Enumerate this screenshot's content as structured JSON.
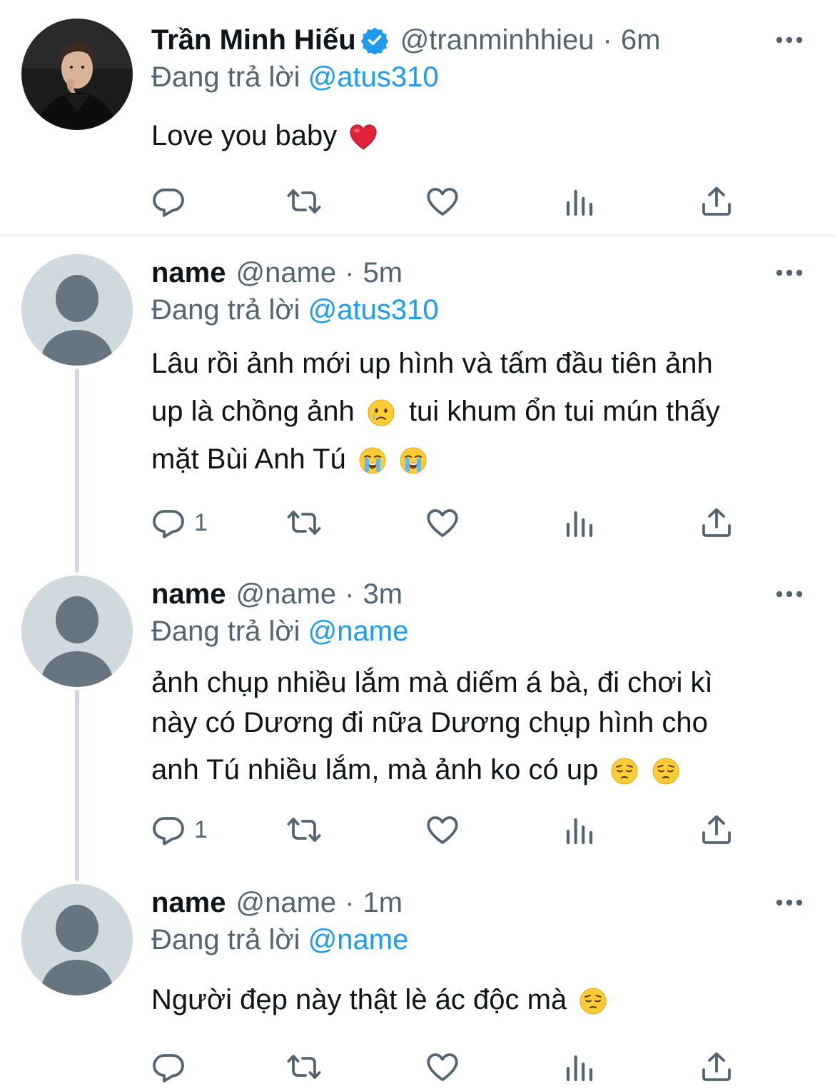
{
  "tweets": [
    {
      "display_name": "Trần Minh Hiếu",
      "verified": true,
      "handle": "@tranminhhieu",
      "time": "6m",
      "replying_label": "Đang trả lời",
      "replying_to": "@atus310",
      "text_lines": [
        "Love you baby"
      ],
      "reply_count": ""
    },
    {
      "display_name": "name",
      "verified": false,
      "handle": "@name",
      "time": "5m",
      "replying_label": "Đang trả lời",
      "replying_to": "@atus310",
      "text_lines": [
        "Lâu rồi ảnh mới up hình và tấm đầu tiên ảnh",
        "up là chồng ảnh",
        "tui khum ổn tui mún thấy",
        "mặt Bùi Anh Tú"
      ],
      "reply_count": "1"
    },
    {
      "display_name": "name",
      "verified": false,
      "handle": "@name",
      "time": "3m",
      "replying_label": "Đang trả lời",
      "replying_to": "@name",
      "text_lines": [
        "ảnh chụp nhiều lắm mà diếm á bà, đi chơi kì",
        "này có Dương đi nữa Dương chụp hình cho",
        "anh Tú nhiều lắm, mà ảnh ko có up"
      ],
      "reply_count": "1"
    },
    {
      "display_name": "name",
      "verified": false,
      "handle": "@name",
      "time": "1m",
      "replying_label": "Đang trả lời",
      "replying_to": "@name",
      "text_lines": [
        "Người đẹp này thật lè ác độc mà"
      ],
      "reply_count": ""
    }
  ],
  "separator": "·",
  "icons": {
    "verified": "verified-badge-icon",
    "more": "more-options-icon",
    "reply": "reply-icon",
    "retweet": "retweet-icon",
    "like": "like-icon",
    "views": "views-icon",
    "share": "share-icon",
    "heart_emoji": "red-heart-emoji",
    "crying_emoji": "crying-face-emoji",
    "sobbing_emoji": "loudly-crying-face-emoji",
    "pensive_emoji": "pensive-face-emoji"
  },
  "colors": {
    "link": "#1d9bf0",
    "muted": "#536471",
    "text": "#0f1419",
    "thread_line": "#cfd9de",
    "divider": "#eff3f4"
  }
}
